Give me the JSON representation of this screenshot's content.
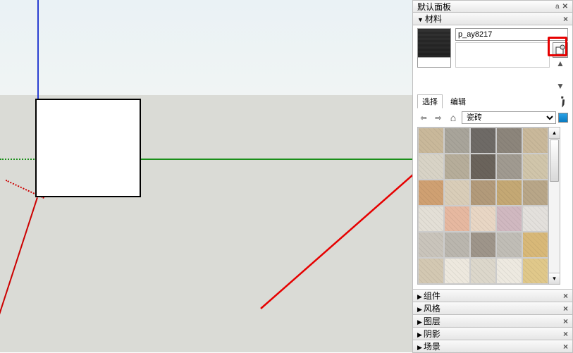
{
  "panel": {
    "title": "默认面板",
    "window_ctrls": {
      "pin": "a",
      "close": "✕"
    }
  },
  "materials": {
    "header": "材料",
    "collapse_icon": "▾",
    "close": "×",
    "swatch_name": "p_ay8217",
    "create_tooltip": "创建材质",
    "arrows": {
      "up": "▲",
      "down": "▼"
    },
    "tabs": [
      "选择",
      "编辑"
    ],
    "active_tab": 0,
    "nav": {
      "back": "⇦",
      "forward": "⇨",
      "home": "⌂",
      "category": "瓷砖",
      "detail": "▦"
    },
    "grid": [
      "#c9b89a",
      "#a8a49a",
      "#6e6a66",
      "#8c857b",
      "#c9b89a",
      "#d8d3c6",
      "#b6ad9a",
      "#6a635b",
      "#a09a90",
      "#d0c5aa",
      "#cfa072",
      "#d9cdb8",
      "#b29a7a",
      "#c4a874",
      "#b8a688",
      "#e3dfd6",
      "#e6b8a0",
      "#e8d6c4",
      "#d0b8c0",
      "#e3e0dc",
      "#c9c4bb",
      "#bab6ae",
      "#9e958a",
      "#c0bdb6",
      "#d8b878",
      "#d3c8b2",
      "#ede8de",
      "#dcd7cb",
      "#ede9e0",
      "#e0c88a"
    ]
  },
  "collapsed_sections": [
    "组件",
    "风格",
    "图层",
    "阴影",
    "场景"
  ]
}
